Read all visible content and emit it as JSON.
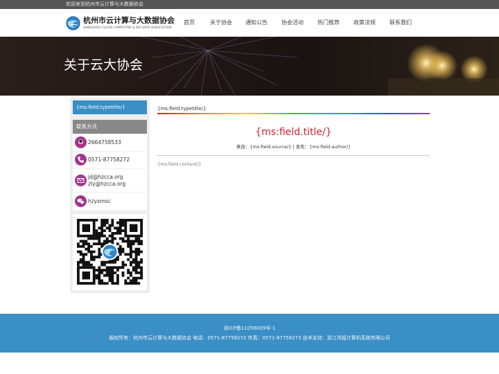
{
  "topbar": {
    "welcome": "欢迎来到杭州市云计算与大数据协会"
  },
  "logo": {
    "name_cn": "杭州市云计算与大数据协会",
    "name_en": "HANGZHOU CLOUD COMPUTING & BIG DATA ASSOCIATION"
  },
  "nav": [
    {
      "label": "首页"
    },
    {
      "label": "关于协会"
    },
    {
      "label": "通知公告"
    },
    {
      "label": "协会活动"
    },
    {
      "label": "热门推荐"
    },
    {
      "label": "政策法规"
    },
    {
      "label": "联系我们"
    }
  ],
  "banner": {
    "title": "关于云大协会"
  },
  "sidebar": {
    "typetitle": "{ms:field.typetitle/}",
    "contact_heading": "联系方式",
    "contacts": [
      {
        "icon": "qq-icon",
        "text": "2664758533"
      },
      {
        "icon": "phone-icon",
        "text": "0571-87758272"
      },
      {
        "icon": "mail-icon",
        "line1": "jd@hzcca.org",
        "line2": "zly@hzcca.org"
      },
      {
        "icon": "wechat-icon",
        "text": "hzyxmsc"
      }
    ]
  },
  "content": {
    "typetitle": "{ms:field.typetitle/}",
    "title": "{ms:field.title/}",
    "meta": "来自：{ms:field.source/} | 发布：{ms:field.author/}",
    "body": "{ms:field.content/}"
  },
  "footer": {
    "icp": "浙ICP备11056009号-1",
    "copyright": "版权所有：杭州市云计算与大数据协会 电话：0571-87758272 传真：0571-87758273 技术支持：浙江鸿程计算机系统有限公司"
  },
  "colors": {
    "accent_blue": "#3a8fc6",
    "title_red": "#c8232c",
    "icon_purple": "#a2358f",
    "topbar_gray": "#555555"
  }
}
